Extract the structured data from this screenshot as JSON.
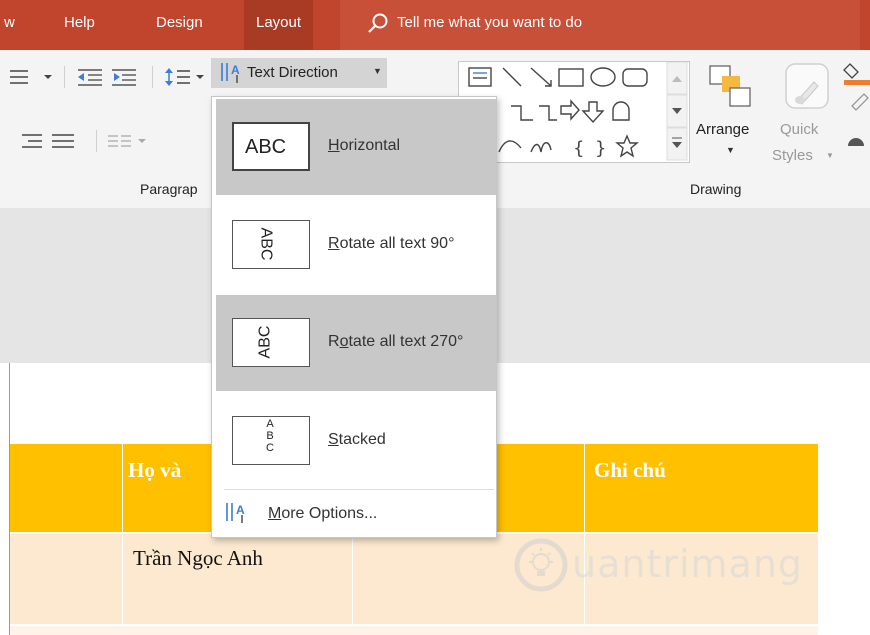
{
  "tabs": {
    "partial": "w",
    "help": "Help",
    "design": "Design",
    "layout": "Layout",
    "tell_me": "Tell me what you want to do"
  },
  "ribbon": {
    "text_direction": "Text Direction",
    "paragraph_group": "Paragrap",
    "drawing_group": "Drawing",
    "arrange": "Arrange",
    "quick": "Quick",
    "styles": "Styles"
  },
  "menu": {
    "items": [
      {
        "label": "Horizontal",
        "accel": "H",
        "rest": "orizontal",
        "preview": "ABC"
      },
      {
        "label": "Rotate all text 90°",
        "accel": "R",
        "rest": "otate all text 90°",
        "preview": "ABC"
      },
      {
        "label": "Rotate all text 270°",
        "pre": "R",
        "accel": "o",
        "rest": "tate all text 270°",
        "preview": "ABC"
      },
      {
        "label": "Stacked",
        "accel": "S",
        "rest": "tacked",
        "preview": "ABC"
      }
    ],
    "more_options": {
      "accel": "M",
      "rest": "ore Options..."
    }
  },
  "table": {
    "headers": [
      "Họ và",
      "Ghi chú"
    ],
    "rows": [
      [
        "Trần Ngọc Anh"
      ]
    ]
  },
  "watermark": "uantrimang",
  "colors": {
    "tabbar": "#c1452d",
    "table_header": "#ffc000",
    "table_row": "#fde9d0",
    "menu_highlight": "#c8c8c8"
  }
}
